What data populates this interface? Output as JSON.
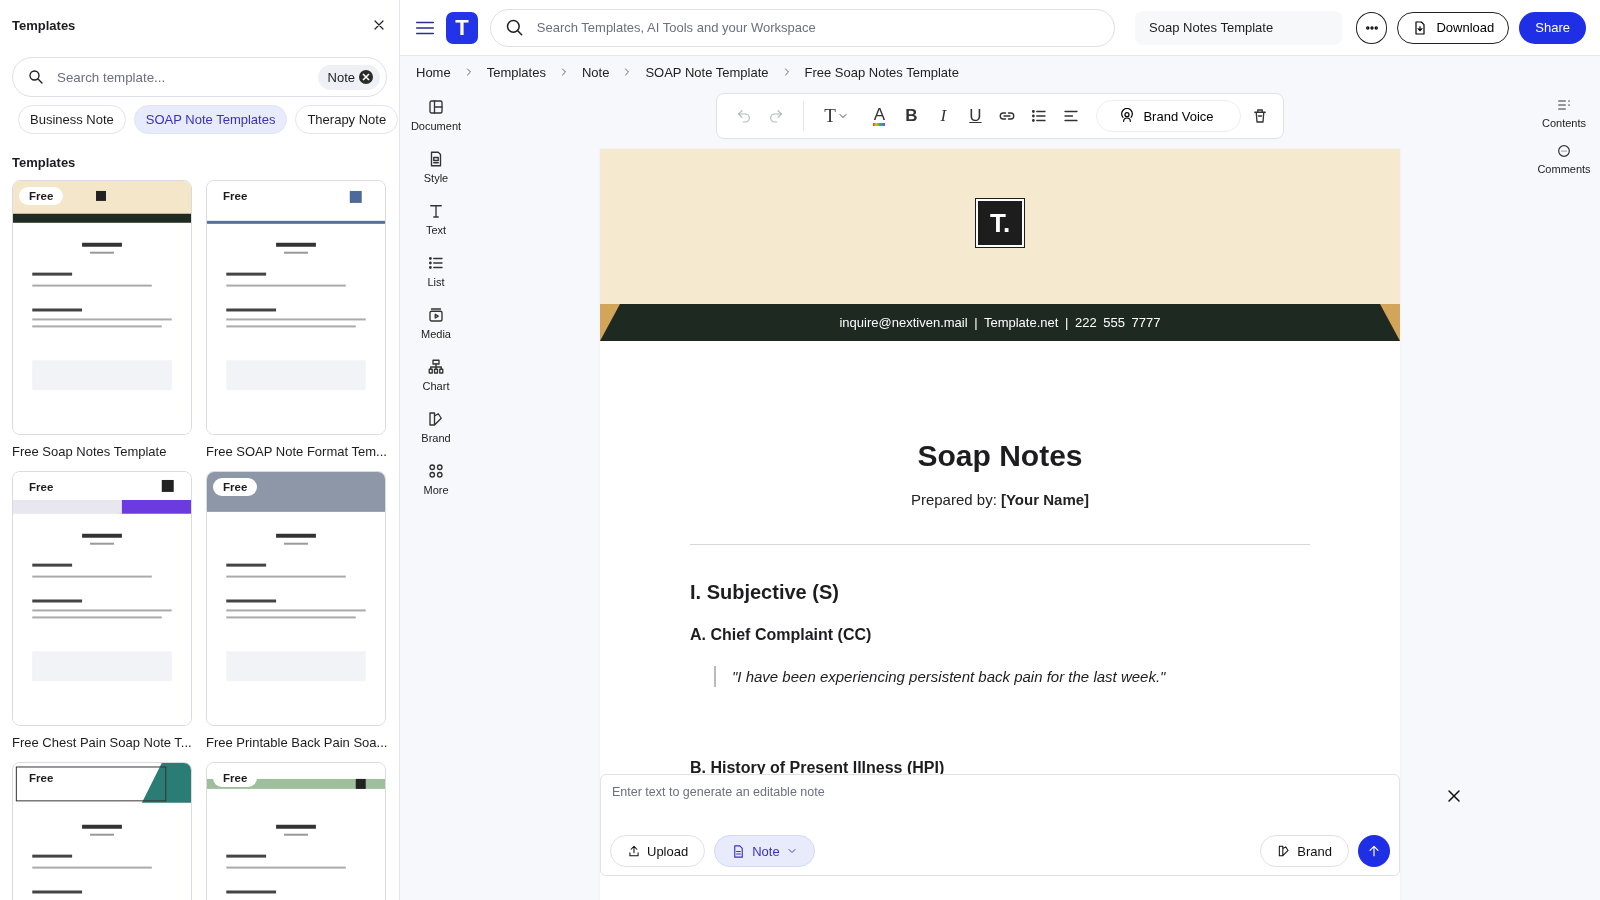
{
  "sidebar": {
    "title": "Templates",
    "search": {
      "placeholder": "Search template...",
      "filter": "Note"
    },
    "categories": [
      {
        "label": "Business Note",
        "selected": false
      },
      {
        "label": "SOAP Note Templates",
        "selected": true
      },
      {
        "label": "Therapy Note",
        "selected": false
      }
    ],
    "section_title": "Templates",
    "templates": [
      {
        "badge": "Free",
        "title": "Free Soap Notes Template",
        "kind": "picture"
      },
      {
        "badge": "Free",
        "title": "Free SOAP Note Format Tem...",
        "kind": "picture"
      },
      {
        "badge": "Free",
        "title": "Free Chest Pain Soap Note T...",
        "kind": "picture"
      },
      {
        "badge": "Free",
        "title": "Free Printable Back Pain Soa...",
        "kind": "picture"
      },
      {
        "badge": "Free",
        "kind": "picture"
      },
      {
        "badge": "Free",
        "kind": "picture"
      }
    ]
  },
  "header": {
    "logo": "T",
    "search_placeholder": "Search Templates, AI Tools and your Workspace",
    "document_name": "Soap Notes Template",
    "download": "Download",
    "share": "Share"
  },
  "breadcrumb": [
    "Home",
    "Templates",
    "Note",
    "SOAP Note Template",
    "Free Soap Notes Template"
  ],
  "tools": [
    {
      "label": "Document"
    },
    {
      "label": "Style"
    },
    {
      "label": "Text"
    },
    {
      "label": "List"
    },
    {
      "label": "Media"
    },
    {
      "label": "Chart"
    },
    {
      "label": "Brand"
    },
    {
      "label": "More"
    }
  ],
  "toolbar": {
    "items": [
      {
        "kind": "undo",
        "disabled": true
      },
      {
        "kind": "redo",
        "disabled": true
      },
      {
        "kind": "text-style",
        "glyph": "T"
      },
      {
        "kind": "color",
        "glyph": "A"
      },
      {
        "kind": "bold",
        "glyph": "B"
      },
      {
        "kind": "italic",
        "glyph": "I"
      },
      {
        "kind": "underline",
        "glyph": "U"
      },
      {
        "kind": "link"
      },
      {
        "kind": "list"
      },
      {
        "kind": "align"
      }
    ],
    "brand_voice": "Brand Voice"
  },
  "right_rail": [
    {
      "label": "Contents"
    },
    {
      "label": "Comments"
    }
  ],
  "document": {
    "logo": "T.",
    "contact": "inquire@nextiven.mail | Template.net | 222 555 7777",
    "title": "Soap Notes",
    "prepared_by": "Prepared by: **[Your Name]**",
    "blocks": [
      {
        "kind": "h1",
        "text": "I. Subjective (S)"
      },
      {
        "kind": "h2",
        "text": "A. Chief Complaint (CC)"
      },
      {
        "kind": "quote",
        "text": "\"I have been experiencing persistent back pain for the last week.\""
      },
      {
        "kind": "h2",
        "text": "B. History of Present Illness (HPI)"
      }
    ]
  },
  "prompt": {
    "placeholder": "Enter text to generate an editable note",
    "upload": "Upload",
    "mode": "Note",
    "brand": "Brand"
  }
}
